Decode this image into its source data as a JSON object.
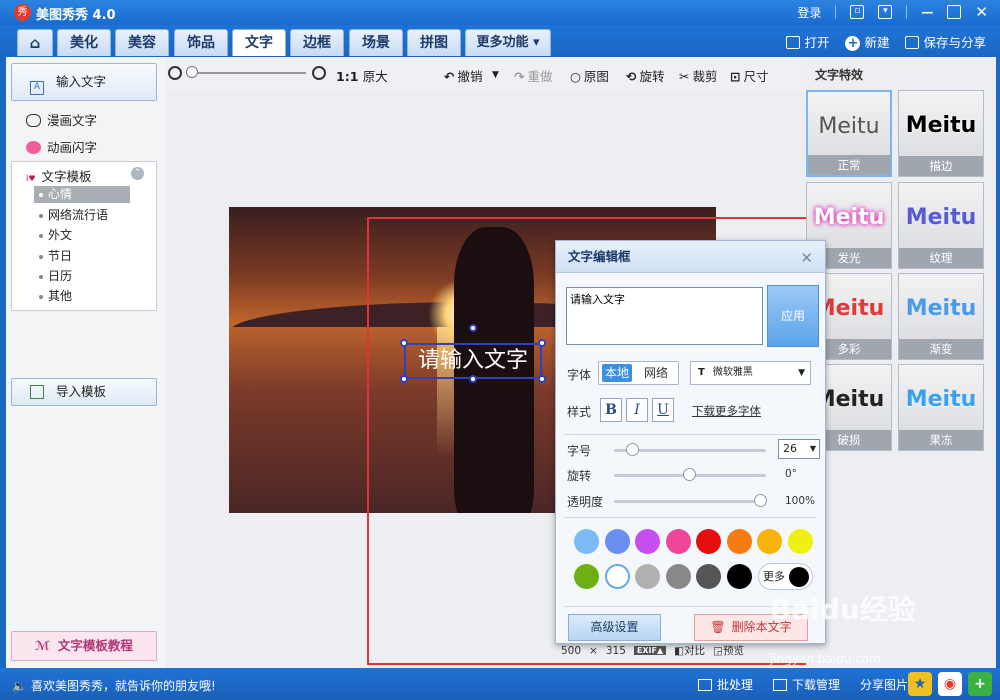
{
  "app": {
    "title": "美图秀秀 4.0",
    "logo_text": "秀"
  },
  "window": {
    "login": "登录"
  },
  "nav": {
    "tabs": [
      "美化",
      "美容",
      "饰品",
      "文字",
      "边框",
      "场景",
      "拼图",
      "更多功能 ▾"
    ],
    "active": "文字",
    "open": "打开",
    "new": "新建",
    "save": "保存与分享"
  },
  "left": {
    "input_text": "输入文字",
    "comic_text": "漫画文字",
    "anim_text": "动画闪字",
    "template_title": "文字模板",
    "template_items": [
      "心情",
      "网络流行语",
      "外文",
      "节日",
      "日历",
      "其他"
    ],
    "template_selected": "心情",
    "import_template": "导入模板",
    "tutorial": "文字模板教程"
  },
  "toolbar": {
    "zoom_ratio": "1:1",
    "original_size": "原大",
    "undo": "撤销",
    "redo": "重做",
    "original": "原图",
    "rotate": "旋转",
    "crop": "裁剪",
    "size": "尺寸"
  },
  "canvas": {
    "text_overlay": "请输入文字",
    "image_width": "500",
    "image_times": "×",
    "image_height": "315",
    "exif": "EXIF▲",
    "compare": "对比",
    "preview": "预览"
  },
  "dialog": {
    "title": "文字编辑框",
    "text_value": "请输入文字",
    "apply": "应用",
    "font_label": "字体",
    "font_local": "本地",
    "font_network": "网络",
    "font_name": "微软雅黑",
    "style_label": "样式",
    "bold": "B",
    "italic": "I",
    "underline": "U",
    "more_fonts": "下载更多字体",
    "size_label": "字号",
    "size_value": "26",
    "rotate_label": "旋转",
    "rotate_value": "0°",
    "opacity_label": "透明度",
    "opacity_value": "100%",
    "more_colors": "更多",
    "advanced": "高级设置",
    "delete": "删除本文字",
    "colors": [
      "#7bbaf5",
      "#6b8ff0",
      "#c74ef0",
      "#f0469a",
      "#e60f0f",
      "#f57c12",
      "#f8b40c",
      "#eef010",
      "#6cb012",
      "#ffffff",
      "#b0b0b0",
      "#888888",
      "#555555",
      "#000000"
    ]
  },
  "effects": {
    "title": "文字特效",
    "sample": "Meitu",
    "items": [
      "正常",
      "描边",
      "发光",
      "纹理",
      "多彩",
      "渐变",
      "破损",
      "果冻"
    ],
    "selected": "正常"
  },
  "status": {
    "message": "喜欢美图秀秀，就告诉你的朋友哦!",
    "batch": "批处理",
    "download": "下载管理",
    "share": "分享图片"
  },
  "watermark": {
    "brand": "Baidu经验",
    "url": "jingyan.baidu.com"
  }
}
